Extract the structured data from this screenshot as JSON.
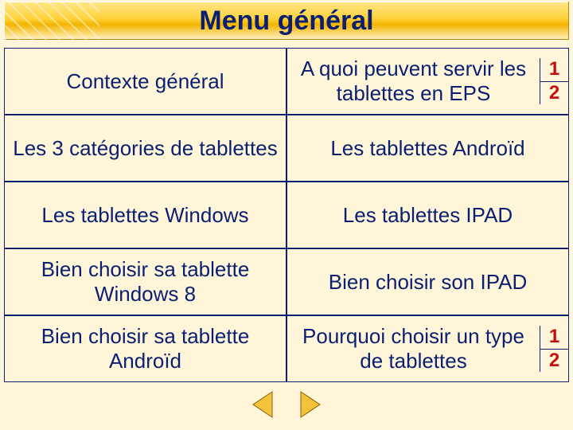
{
  "title": "Menu général",
  "menu": {
    "rows": [
      {
        "left": {
          "label": "Contexte général",
          "split": false
        },
        "right": {
          "label": "A quoi peuvent servir les tablettes en EPS",
          "split": true,
          "nums": [
            "1",
            "2"
          ]
        }
      },
      {
        "left": {
          "label": "Les 3 catégories de tablettes",
          "split": false
        },
        "right": {
          "label": "Les tablettes Androïd",
          "split": false
        }
      },
      {
        "left": {
          "label": "Les tablettes Windows",
          "split": false
        },
        "right": {
          "label": "Les tablettes IPAD",
          "split": false
        }
      },
      {
        "left": {
          "label": "Bien choisir sa tablette Windows 8",
          "split": false
        },
        "right": {
          "label": "Bien choisir son IPAD",
          "split": false
        }
      },
      {
        "left": {
          "label": "Bien choisir sa tablette Androïd",
          "split": false
        },
        "right": {
          "label": "Pourquoi choisir un type de tablettes",
          "split": true,
          "nums": [
            "1",
            "2"
          ]
        }
      }
    ]
  },
  "nav": {
    "prev": "◀",
    "next": "▶"
  },
  "colors": {
    "accent": "#0a1f72",
    "highlight": "#c21010"
  }
}
